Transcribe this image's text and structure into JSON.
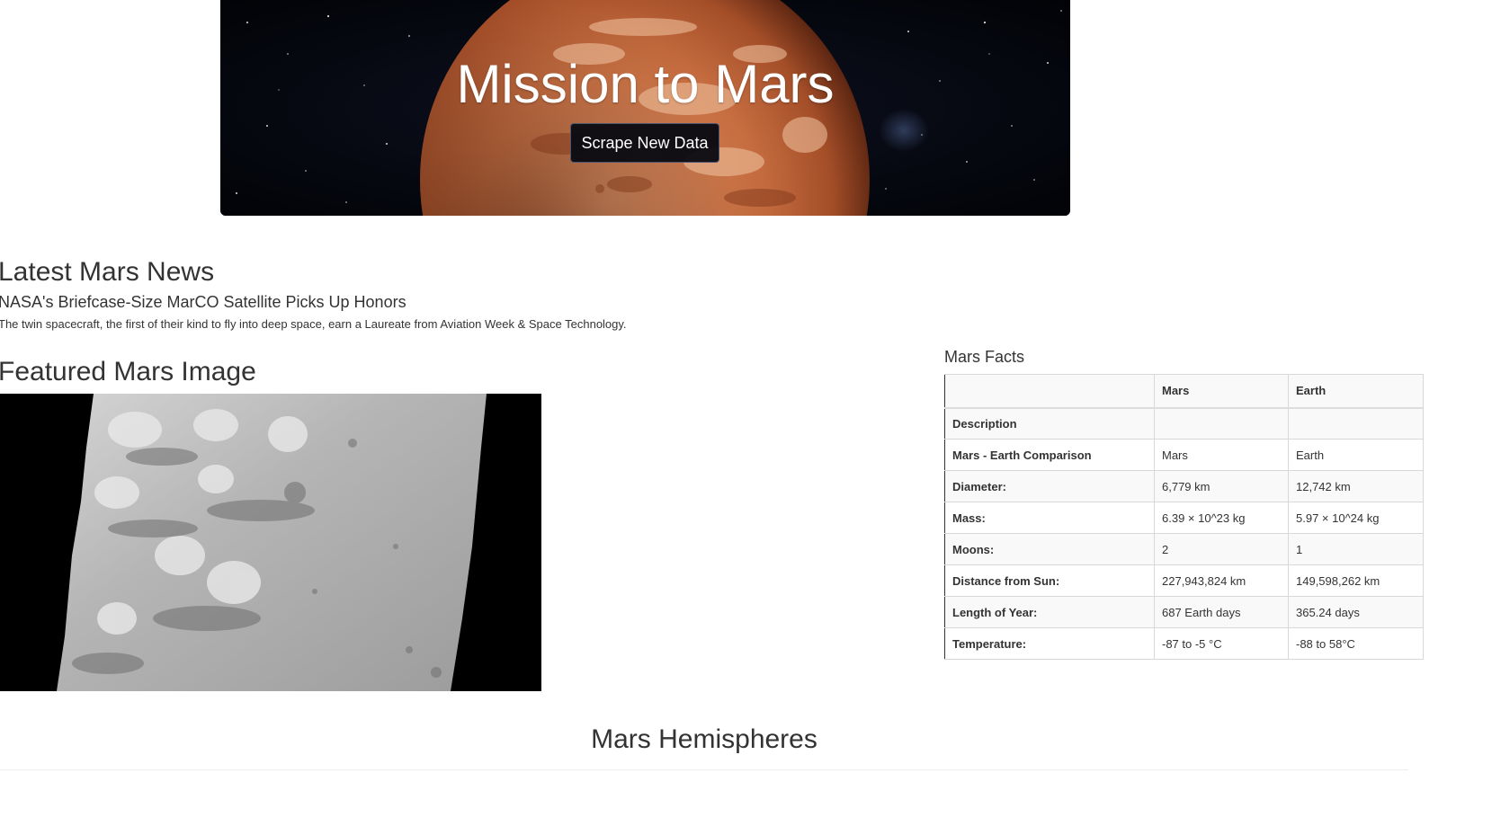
{
  "header": {
    "title": "Mission to Mars",
    "scrape_button": "Scrape New Data"
  },
  "news": {
    "heading": "Latest Mars News",
    "title": "NASA's Briefcase-Size MarCO Satellite Picks Up Honors",
    "teaser": "The twin spacecraft, the first of their kind to fly into deep space, earn a Laureate from Aviation Week & Space Technology."
  },
  "featured": {
    "heading": "Featured Mars Image"
  },
  "facts": {
    "heading": "Mars Facts",
    "columns": [
      "",
      "Mars",
      "Earth"
    ],
    "rows": [
      [
        "Description",
        "",
        ""
      ],
      [
        "Mars - Earth Comparison",
        "Mars",
        "Earth"
      ],
      [
        "Diameter:",
        "6,779 km",
        "12,742 km"
      ],
      [
        "Mass:",
        "6.39 × 10^23 kg",
        "5.97 × 10^24 kg"
      ],
      [
        "Moons:",
        "2",
        "1"
      ],
      [
        "Distance from Sun:",
        "227,943,824 km",
        "149,598,262 km"
      ],
      [
        "Length of Year:",
        "687 Earth days",
        "365.24 days"
      ],
      [
        "Temperature:",
        "-87 to -5 °C",
        "-88 to 58°C"
      ]
    ]
  },
  "hemispheres": {
    "heading": "Mars Hemispheres"
  }
}
